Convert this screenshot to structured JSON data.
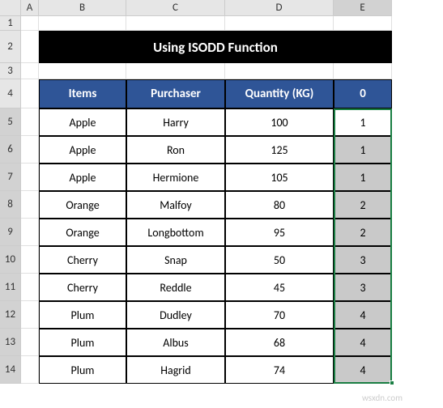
{
  "columns": {
    "A": "A",
    "B": "B",
    "C": "C",
    "D": "D",
    "E": "E"
  },
  "rows": {
    "1": "1",
    "2": "2",
    "3": "3",
    "4": "4",
    "5": "5",
    "6": "6",
    "7": "7",
    "8": "8",
    "9": "9",
    "10": "10",
    "11": "11",
    "12": "12",
    "13": "13",
    "14": "14"
  },
  "title": "Using ISODD Function",
  "headers": {
    "items": "Items",
    "purchaser": "Purchaser",
    "quantity": "Quantity (KG)",
    "idx": "0"
  },
  "data": [
    {
      "item": "Apple",
      "purchaser": "Harry",
      "qty": "100",
      "idx": "1",
      "gray": false
    },
    {
      "item": "Apple",
      "purchaser": "Ron",
      "qty": "125",
      "idx": "1",
      "gray": true
    },
    {
      "item": "Apple",
      "purchaser": "Hermione",
      "qty": "105",
      "idx": "1",
      "gray": true
    },
    {
      "item": "Orange",
      "purchaser": "Malfoy",
      "qty": "80",
      "idx": "2",
      "gray": true
    },
    {
      "item": "Orange",
      "purchaser": "Longbottom",
      "qty": "95",
      "idx": "2",
      "gray": true
    },
    {
      "item": "Cherry",
      "purchaser": "Snap",
      "qty": "50",
      "idx": "3",
      "gray": true
    },
    {
      "item": "Cherry",
      "purchaser": "Reddle",
      "qty": "45",
      "idx": "3",
      "gray": true
    },
    {
      "item": "Plum",
      "purchaser": "Dudley",
      "qty": "70",
      "idx": "4",
      "gray": true
    },
    {
      "item": "Plum",
      "purchaser": "Albus",
      "qty": "68",
      "idx": "4",
      "gray": true
    },
    {
      "item": "Plum",
      "purchaser": "Hagrid",
      "qty": "74",
      "idx": "4",
      "gray": true
    }
  ],
  "watermark": "wsxdn.com",
  "chart_data": {
    "type": "table",
    "title": "Using ISODD Function",
    "columns": [
      "Items",
      "Purchaser",
      "Quantity (KG)",
      "0"
    ],
    "rows": [
      [
        "Apple",
        "Harry",
        100,
        1
      ],
      [
        "Apple",
        "Ron",
        125,
        1
      ],
      [
        "Apple",
        "Hermione",
        105,
        1
      ],
      [
        "Orange",
        "Malfoy",
        80,
        2
      ],
      [
        "Orange",
        "Longbottom",
        95,
        2
      ],
      [
        "Cherry",
        "Snap",
        50,
        3
      ],
      [
        "Cherry",
        "Reddle",
        45,
        3
      ],
      [
        "Plum",
        "Dudley",
        70,
        4
      ],
      [
        "Plum",
        "Albus",
        68,
        4
      ],
      [
        "Plum",
        "Hagrid",
        74,
        4
      ]
    ]
  }
}
